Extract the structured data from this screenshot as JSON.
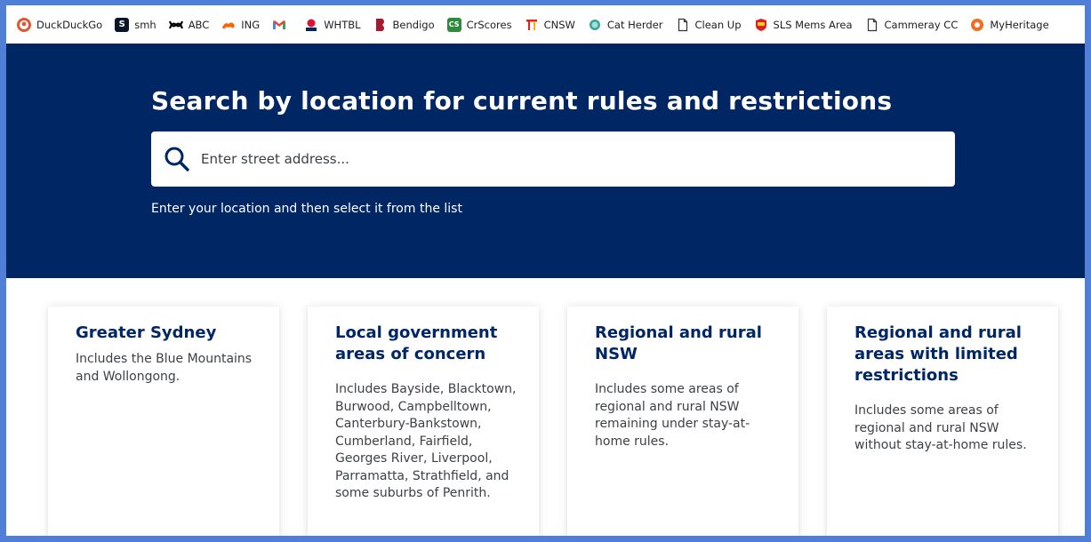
{
  "bookmarks": [
    {
      "label": "DuckDuckGo",
      "icon": "duckduckgo-icon",
      "color": "#de5833"
    },
    {
      "label": "smh",
      "icon": "smh-icon",
      "color": "#0a1628"
    },
    {
      "label": "ABC",
      "icon": "abc-icon",
      "color": "#000000"
    },
    {
      "label": "ING",
      "icon": "ing-lion-icon",
      "color": "#ff6200"
    },
    {
      "label": "",
      "icon": "gmail-icon",
      "color": "#ea4335"
    },
    {
      "label": "WHTBL",
      "icon": "nsw-waratah-icon",
      "color": "#d7153a"
    },
    {
      "label": "Bendigo",
      "icon": "bendigo-icon",
      "color": "#a6192e"
    },
    {
      "label": "CrScores",
      "icon": "crscores-icon",
      "color": "#2e8b3d"
    },
    {
      "label": "CNSW",
      "icon": "cnsw-icon",
      "color": "#e2231a"
    },
    {
      "label": "Cat Herder",
      "icon": "cat-herder-icon",
      "color": "#3aa39b"
    },
    {
      "label": "Clean Up",
      "icon": "page-icon",
      "color": "#5f6368"
    },
    {
      "label": "SLS Mems Area",
      "icon": "sls-icon",
      "color": "#e41b23"
    },
    {
      "label": "Cammeray CC",
      "icon": "page-icon",
      "color": "#5f6368"
    },
    {
      "label": "MyHeritage",
      "icon": "myheritage-icon",
      "color": "#f26d21"
    }
  ],
  "hero": {
    "title": "Search by location for current rules and restrictions",
    "search_placeholder": "Enter street address...",
    "hint": "Enter your location and then select it from the list"
  },
  "cards": [
    {
      "title": "Greater Sydney",
      "body": "Includes the Blue Mountains and Wollongong."
    },
    {
      "title": "Local government areas of concern",
      "body": "Includes Bayside, Blacktown, Burwood, Campbelltown, Canterbury-Bankstown, Cumberland, Fairfield, Georges River, Liverpool, Parramatta, Strathfield, and some suburbs of Penrith."
    },
    {
      "title": "Regional and rural NSW",
      "body": "Includes some areas of regional and rural NSW remaining under stay-at-home rules."
    },
    {
      "title": "Regional and rural areas with limited restrictions",
      "body": "Includes some areas of regional and rural NSW without stay-at-home rules."
    }
  ],
  "colors": {
    "hero_bg": "#002664",
    "card_title": "#002664",
    "frame": "#4f7fd6"
  }
}
